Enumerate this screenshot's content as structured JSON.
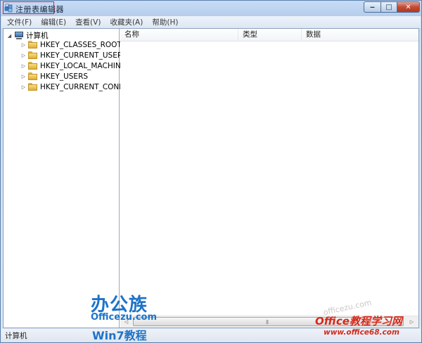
{
  "window": {
    "title": "注册表编辑器",
    "icon": "registry-editor-icon",
    "controls": {
      "minimize": "‒",
      "maximize": "□",
      "close": "✕"
    },
    "accent_colors": {
      "title_highlight": "#d81f3c",
      "close_button": "#c24b34"
    }
  },
  "menu": {
    "items": [
      {
        "label": "文件(F)"
      },
      {
        "label": "编辑(E)"
      },
      {
        "label": "查看(V)"
      },
      {
        "label": "收藏夹(A)"
      },
      {
        "label": "帮助(H)"
      }
    ]
  },
  "tree": {
    "root": {
      "label": "计算机",
      "icon": "computer-icon",
      "expand": "◢"
    },
    "items": [
      {
        "label": "HKEY_CLASSES_ROOT",
        "expand": "▷"
      },
      {
        "label": "HKEY_CURRENT_USER",
        "expand": "▷"
      },
      {
        "label": "HKEY_LOCAL_MACHINE",
        "expand": "▷"
      },
      {
        "label": "HKEY_USERS",
        "expand": "▷"
      },
      {
        "label": "HKEY_CURRENT_CONFIG",
        "expand": "▷"
      }
    ]
  },
  "list": {
    "columns": [
      {
        "label": "名称"
      },
      {
        "label": "类型"
      },
      {
        "label": "数据"
      }
    ]
  },
  "scrollbar": {
    "left": "◁",
    "right": "▷",
    "grip": "|||"
  },
  "status": {
    "path": "计算机"
  },
  "watermarks": {
    "logo": "办公族",
    "site": "Officezu.com",
    "win7": "Win7教程",
    "faint": "officezu.com",
    "office_cn": "Office教程学习网",
    "office_url": "www.office68.com"
  }
}
